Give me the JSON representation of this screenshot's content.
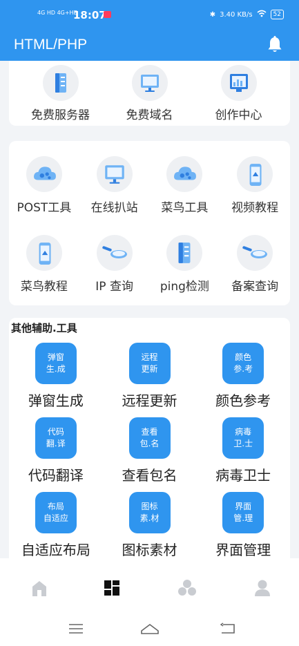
{
  "status": {
    "signal1": "4G HD",
    "signal2": "4G+HD",
    "time": "18:07",
    "speed": "3.40 KB/s",
    "battery": "52"
  },
  "header": {
    "title": "HTML/PHP",
    "bell_icon": "bell-icon"
  },
  "top_card": {
    "items": [
      {
        "label": "免费服务器",
        "icon": "server-icon"
      },
      {
        "label": "免费域名",
        "icon": "monitor-icon"
      },
      {
        "label": "创作中心",
        "icon": "chart-screen-icon"
      }
    ]
  },
  "tools_card": {
    "rows": [
      [
        {
          "label": "POST工具",
          "icon": "cloud-icon"
        },
        {
          "label": "在线扒站",
          "icon": "monitor-icon"
        },
        {
          "label": "菜鸟工具",
          "icon": "cloud-icon"
        },
        {
          "label": "视频教程",
          "icon": "phone-icon"
        }
      ],
      [
        {
          "label": "菜鸟教程",
          "icon": "phone-icon"
        },
        {
          "label": "IP 查询",
          "icon": "magnifier-icon"
        },
        {
          "label": "ping检测",
          "icon": "server-icon"
        },
        {
          "label": "备案查询",
          "icon": "magnifier-icon"
        }
      ]
    ]
  },
  "aux": {
    "title": "其他辅助.工具",
    "rows": [
      [
        {
          "tile": "弹窗\n生.成",
          "label": "弹窗生成"
        },
        {
          "tile": "远程\n更新",
          "label": "远程更新"
        },
        {
          "tile": "颜色\n参.考",
          "label": "颜色参考"
        }
      ],
      [
        {
          "tile": "代码\n翻.译",
          "label": "代码翻译"
        },
        {
          "tile": "查看\n包.名",
          "label": "查看包名"
        },
        {
          "tile": "病毒\n卫.士",
          "label": "病毒卫士"
        }
      ],
      [
        {
          "tile": "布局\n自适应",
          "label": "自适应布局"
        },
        {
          "tile": "图标\n素.材",
          "label": "图标素材"
        },
        {
          "tile": "界面\n管.理",
          "label": "界面管理"
        }
      ]
    ]
  },
  "tabbar": {
    "tabs": [
      "home-icon",
      "dashboard-icon",
      "group-icon",
      "profile-icon"
    ],
    "active": 1
  },
  "colors": {
    "brand": "#2f95ef",
    "icon_light": "#6fb3f5",
    "icon_dark": "#2f7fe0"
  }
}
